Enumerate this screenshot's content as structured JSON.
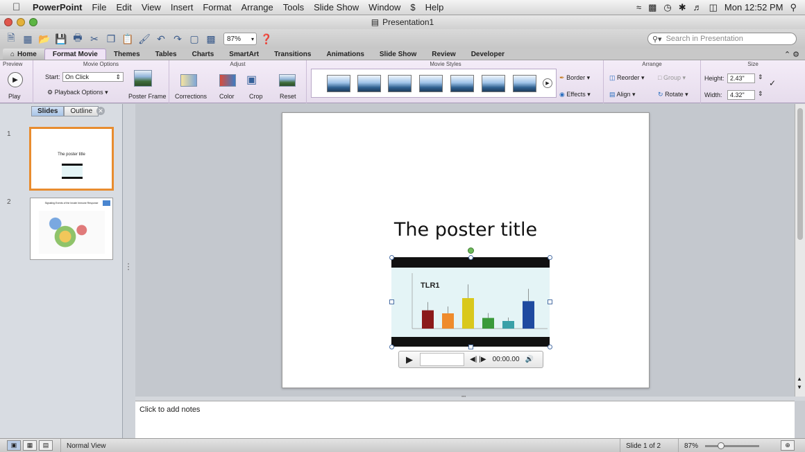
{
  "menubar": {
    "app_name": "PowerPoint",
    "items": [
      "File",
      "Edit",
      "View",
      "Insert",
      "Format",
      "Arrange",
      "Tools",
      "Slide Show",
      "Window",
      "Help"
    ],
    "clock": "Mon 12:52 PM"
  },
  "window": {
    "title": "Presentation1"
  },
  "toolbar": {
    "zoom": "87%",
    "search_placeholder": "Search in Presentation"
  },
  "ribbon": {
    "tabs": [
      "Home",
      "Format Movie",
      "Themes",
      "Tables",
      "Charts",
      "SmartArt",
      "Transitions",
      "Animations",
      "Slide Show",
      "Review",
      "Developer"
    ],
    "active_tab": "Format Movie",
    "groups": {
      "preview": {
        "title": "Preview",
        "play_label": "Play"
      },
      "movie_options": {
        "title": "Movie Options",
        "start_label": "Start:",
        "start_value": "On Click",
        "playback_label": "Playback Options",
        "poster_label": "Poster Frame"
      },
      "adjust": {
        "title": "Adjust",
        "corrections": "Corrections",
        "color": "Color",
        "crop": "Crop",
        "reset": "Reset"
      },
      "movie_styles": {
        "title": "Movie Styles",
        "border": "Border",
        "effects": "Effects"
      },
      "arrange": {
        "title": "Arrange",
        "reorder": "Reorder",
        "group": "Group",
        "align": "Align",
        "rotate": "Rotate"
      },
      "size": {
        "title": "Size",
        "height_label": "Height:",
        "height_value": "2.43\"",
        "width_label": "Width:",
        "width_value": "4.32\""
      }
    }
  },
  "sidebar": {
    "tabs": [
      "Slides",
      "Outline"
    ],
    "active_tab": "Slides",
    "slides": [
      {
        "number": "1",
        "title": "The poster title"
      },
      {
        "number": "2",
        "title": "Signaling Events of the Innate Immune Response"
      }
    ]
  },
  "slide": {
    "title": "The poster title",
    "movie_chart_title": "TLR1",
    "player_time": "00:00.00"
  },
  "chart_data": {
    "type": "bar",
    "title": "TLR1",
    "categories": [
      "",
      "",
      "",
      "",
      "",
      ""
    ],
    "values": [
      1.2,
      1.0,
      2.0,
      0.7,
      0.5,
      1.8
    ],
    "colors": [
      "#8b1a1a",
      "#ef8b2c",
      "#d9c81c",
      "#3a9a3a",
      "#3aa0a8",
      "#1f4aa0"
    ]
  },
  "notes": {
    "placeholder": "Click to add notes"
  },
  "status": {
    "view": "Normal View",
    "slide_position": "Slide 1 of 2",
    "zoom": "87%"
  },
  "colors": {
    "ribbon_accent": "#efe3f5",
    "selection_orange": "#e88c2f"
  }
}
